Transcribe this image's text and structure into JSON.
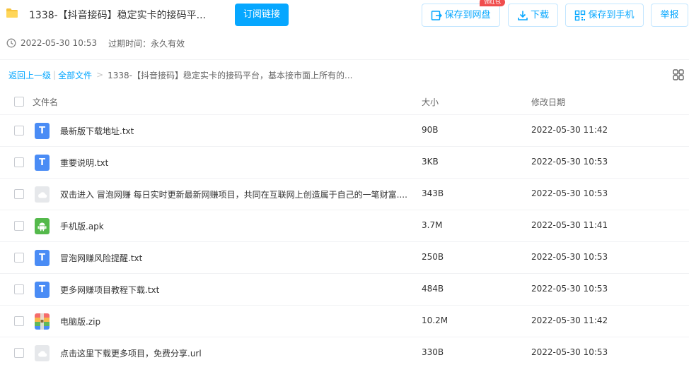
{
  "header": {
    "title": "1338-【抖音接码】稳定实卡的接码平...",
    "subscribe_label": "订阅链接",
    "save_label": "保存到网盘",
    "red_badge": "领红包",
    "download_label": "下载",
    "phone_label": "保存到手机",
    "report_label": "举报"
  },
  "meta": {
    "created": "2022-05-30 10:53",
    "expire": "过期时间：永久有效"
  },
  "breadcrumb": {
    "back": "返回上一级",
    "all_files": "全部文件",
    "current": "1338-【抖音接码】稳定实卡的接码平台，基本接市面上所有的..."
  },
  "table": {
    "headers": {
      "name": "文件名",
      "size": "大小",
      "date": "修改日期"
    },
    "rows": [
      {
        "icon": "txt-file-icon",
        "name": "最新版下载地址.txt",
        "size": "90B",
        "date": "2022-05-30 11:42"
      },
      {
        "icon": "txt-file-icon",
        "name": "重要说明.txt",
        "size": "3KB",
        "date": "2022-05-30 10:53"
      },
      {
        "icon": "link-file-icon",
        "name": "双击进入 冒泡网赚 每日实时更新最新网赚项目，共同在互联网上创造属于自己的一笔财富....",
        "size": "343B",
        "date": "2022-05-30 10:53"
      },
      {
        "icon": "apk-file-icon",
        "name": "手机版.apk",
        "size": "3.7M",
        "date": "2022-05-30 11:41"
      },
      {
        "icon": "txt-file-icon",
        "name": "冒泡网赚风险提醒.txt",
        "size": "250B",
        "date": "2022-05-30 10:53"
      },
      {
        "icon": "txt-file-icon",
        "name": "更多网赚项目教程下载.txt",
        "size": "484B",
        "date": "2022-05-30 10:53"
      },
      {
        "icon": "zip-file-icon",
        "name": "电脑版.zip",
        "size": "10.2M",
        "date": "2022-05-30 11:42"
      },
      {
        "icon": "link-file-icon",
        "name": "点击这里下载更多项目，免费分享.url",
        "size": "330B",
        "date": "2022-05-30 10:53"
      }
    ]
  },
  "colors": {
    "accent": "#06a7ff",
    "badge": "#f04d4d",
    "txt_icon": "#4a8cf5",
    "apk_icon": "#54b94b"
  }
}
